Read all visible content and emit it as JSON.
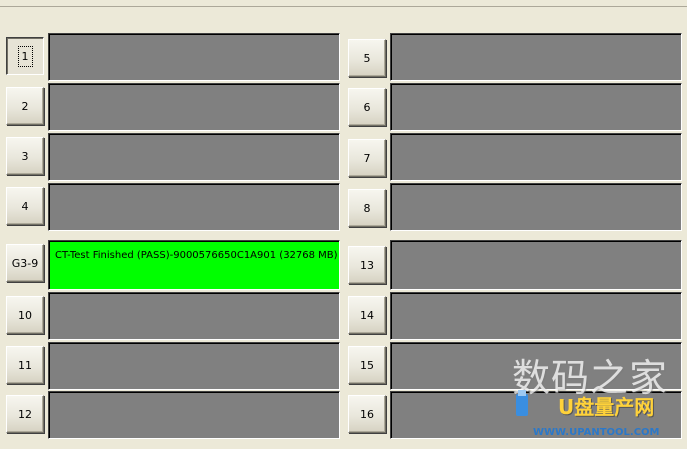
{
  "slots_left": [
    {
      "button_label": "1",
      "status": ""
    },
    {
      "button_label": "2",
      "status": ""
    },
    {
      "button_label": "3",
      "status": ""
    },
    {
      "button_label": "4",
      "status": ""
    },
    {
      "button_label": "G3-9",
      "status": "CT-Test Finished (PASS)-9000576650C1A901 (32768 MB)"
    },
    {
      "button_label": "10",
      "status": ""
    },
    {
      "button_label": "11",
      "status": ""
    },
    {
      "button_label": "12",
      "status": ""
    }
  ],
  "slots_right": [
    {
      "button_label": "5",
      "status": ""
    },
    {
      "button_label": "6",
      "status": ""
    },
    {
      "button_label": "7",
      "status": ""
    },
    {
      "button_label": "8",
      "status": ""
    },
    {
      "button_label": "13",
      "status": ""
    },
    {
      "button_label": "14",
      "status": ""
    },
    {
      "button_label": "15",
      "status": ""
    },
    {
      "button_label": "16",
      "status": ""
    }
  ],
  "colors": {
    "idle_panel": "#808080",
    "pass_panel": "#00ff00",
    "window_bg": "#ece9d8"
  },
  "watermark": {
    "cn_text": "数码之家",
    "site_text": "U盘量产网",
    "url_text": "WWW.UPANTOOL.COM"
  }
}
